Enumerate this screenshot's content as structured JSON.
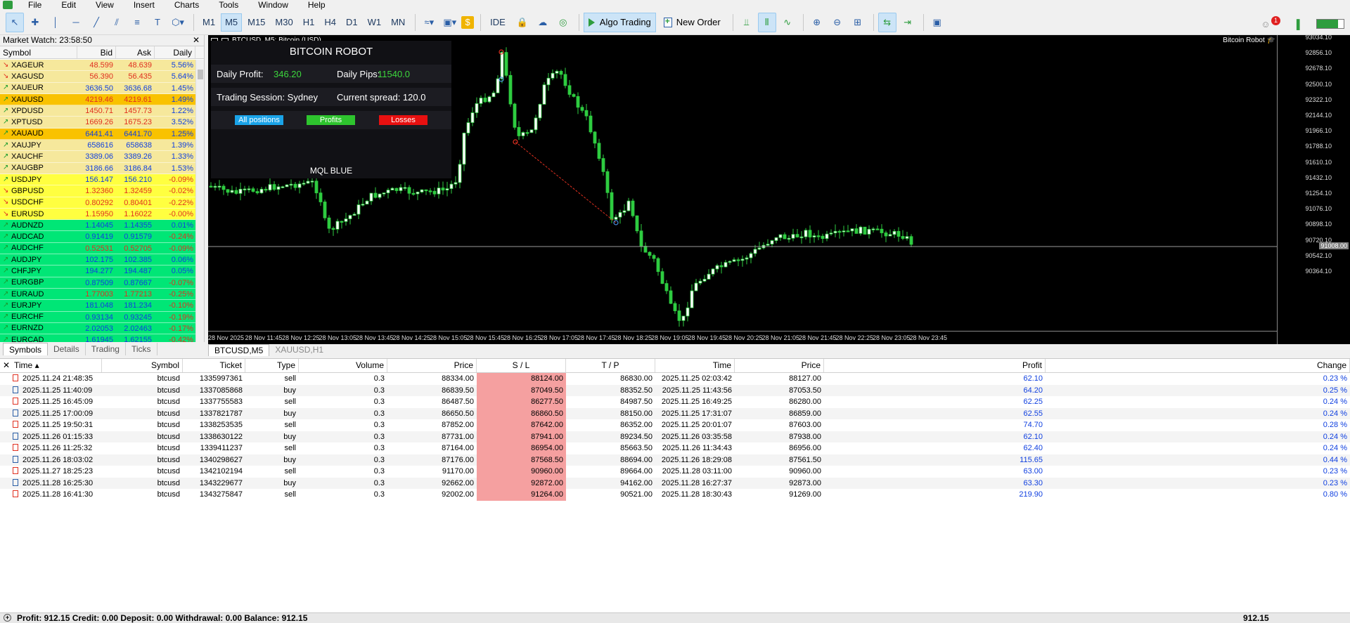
{
  "menu": [
    "File",
    "Edit",
    "View",
    "Insert",
    "Charts",
    "Tools",
    "Window",
    "Help"
  ],
  "toolbar": {
    "timeframes": [
      "M1",
      "M5",
      "M15",
      "M30",
      "H1",
      "H4",
      "D1",
      "W1",
      "MN"
    ],
    "active_timeframe": "M5",
    "ide_label": "IDE",
    "algo_trading_label": "Algo Trading",
    "new_order_label": "New Order",
    "notification_count": "1",
    "signal_level": 0.8
  },
  "market_watch": {
    "title": "Market Watch: 23:58:50",
    "columns": [
      "Symbol",
      "Bid",
      "Ask",
      "Daily Ch..."
    ],
    "rows": [
      {
        "symbol": "XAGEUR",
        "dir": "down",
        "bid": "48.599",
        "ask": "48.639",
        "change": "5.56%",
        "bg": "#f6e89c",
        "color": "red"
      },
      {
        "symbol": "XAGUSD",
        "dir": "down",
        "bid": "56.390",
        "ask": "56.435",
        "change": "5.64%",
        "bg": "#f6e89c",
        "color": "red"
      },
      {
        "symbol": "XAUEUR",
        "dir": "up",
        "bid": "3636.50",
        "ask": "3636.68",
        "change": "1.45%",
        "bg": "#f6e89c",
        "color": "blue"
      },
      {
        "symbol": "XAUUSD",
        "dir": "up",
        "bid": "4219.46",
        "ask": "4219.61",
        "change": "1.49%",
        "bg": "#f9c200",
        "color": "red"
      },
      {
        "symbol": "XPDUSD",
        "dir": "up",
        "bid": "1450.71",
        "ask": "1457.73",
        "change": "1.22%",
        "bg": "#f6e89c",
        "color": "red"
      },
      {
        "symbol": "XPTUSD",
        "dir": "up",
        "bid": "1669.26",
        "ask": "1675.23",
        "change": "3.52%",
        "bg": "#f6e89c",
        "color": "red"
      },
      {
        "symbol": "XAUAUD",
        "dir": "up",
        "bid": "6441.41",
        "ask": "6441.70",
        "change": "1.25%",
        "bg": "#f9c200",
        "color": "blue"
      },
      {
        "symbol": "XAUJPY",
        "dir": "up",
        "bid": "658616",
        "ask": "658638",
        "change": "1.39%",
        "bg": "#f6e89c",
        "color": "blue"
      },
      {
        "symbol": "XAUCHF",
        "dir": "up",
        "bid": "3389.06",
        "ask": "3389.26",
        "change": "1.33%",
        "bg": "#f6e89c",
        "color": "blue"
      },
      {
        "symbol": "XAUGBP",
        "dir": "up",
        "bid": "3186.66",
        "ask": "3186.84",
        "change": "1.53%",
        "bg": "#f6e89c",
        "color": "blue"
      },
      {
        "symbol": "USDJPY",
        "dir": "up",
        "bid": "156.147",
        "ask": "156.210",
        "change": "-0.09%",
        "bg": "#ffff40",
        "color": "blue"
      },
      {
        "symbol": "GBPUSD",
        "dir": "down",
        "bid": "1.32360",
        "ask": "1.32459",
        "change": "-0.02%",
        "bg": "#ffff40",
        "color": "red"
      },
      {
        "symbol": "USDCHF",
        "dir": "down",
        "bid": "0.80292",
        "ask": "0.80401",
        "change": "-0.22%",
        "bg": "#ffff40",
        "color": "red"
      },
      {
        "symbol": "EURUSD",
        "dir": "down",
        "bid": "1.15950",
        "ask": "1.16022",
        "change": "-0.00%",
        "bg": "#ffff40",
        "color": "red"
      },
      {
        "symbol": "AUDNZD",
        "dir": "up",
        "bid": "1.14045",
        "ask": "1.14355",
        "change": "0.01%",
        "bg": "#00e676",
        "color": "blue"
      },
      {
        "symbol": "AUDCAD",
        "dir": "up",
        "bid": "0.91419",
        "ask": "0.91579",
        "change": "-0.24%",
        "bg": "#00e676",
        "color": "blue"
      },
      {
        "symbol": "AUDCHF",
        "dir": "up",
        "bid": "0.52531",
        "ask": "0.52705",
        "change": "-0.09%",
        "bg": "#00e676",
        "color": "red"
      },
      {
        "symbol": "AUDJPY",
        "dir": "up",
        "bid": "102.175",
        "ask": "102.385",
        "change": "0.06%",
        "bg": "#00e676",
        "color": "blue"
      },
      {
        "symbol": "CHFJPY",
        "dir": "up",
        "bid": "194.277",
        "ask": "194.487",
        "change": "0.05%",
        "bg": "#00e676",
        "color": "blue"
      },
      {
        "symbol": "EURGBP",
        "dir": "up",
        "bid": "0.87509",
        "ask": "0.87667",
        "change": "-0.07%",
        "bg": "#00e676",
        "color": "blue"
      },
      {
        "symbol": "EURAUD",
        "dir": "up",
        "bid": "1.77003",
        "ask": "1.77213",
        "change": "-0.25%",
        "bg": "#00e676",
        "color": "red"
      },
      {
        "symbol": "EURJPY",
        "dir": "up",
        "bid": "181.048",
        "ask": "181.234",
        "change": "-0.10%",
        "bg": "#00e676",
        "color": "blue"
      },
      {
        "symbol": "EURCHF",
        "dir": "up",
        "bid": "0.93134",
        "ask": "0.93245",
        "change": "-0.19%",
        "bg": "#00e676",
        "color": "blue"
      },
      {
        "symbol": "EURNZD",
        "dir": "up",
        "bid": "2.02053",
        "ask": "2.02463",
        "change": "-0.17%",
        "bg": "#00e676",
        "color": "blue"
      },
      {
        "symbol": "EURCAD",
        "dir": "up",
        "bid": "1.61945",
        "ask": "1.62155",
        "change": "-0.42%",
        "bg": "#00e676",
        "color": "blue"
      }
    ],
    "tabs": [
      "Symbols",
      "Details",
      "Trading",
      "Ticks"
    ]
  },
  "chart": {
    "title": "BTCUSD, M5:  Bitcoin (USD)",
    "robot_label": "Bitcoin Robot",
    "current_price": "91008.00",
    "price_labels": [
      "93034.10",
      "92856.10",
      "92678.10",
      "92500.10",
      "92322.10",
      "92144.10",
      "91966.10",
      "91788.10",
      "91610.10",
      "91432.10",
      "91254.10",
      "91076.10",
      "90898.10",
      "90720.10",
      "90542.10",
      "90364.10"
    ],
    "time_labels": [
      "28 Nov 2025",
      "28 Nov 11:45",
      "28 Nov 12:25",
      "28 Nov 13:05",
      "28 Nov 13:45",
      "28 Nov 14:25",
      "28 Nov 15:05",
      "28 Nov 15:45",
      "28 Nov 16:25",
      "28 Nov 17:05",
      "28 Nov 17:45",
      "28 Nov 18:25",
      "28 Nov 19:05",
      "28 Nov 19:45",
      "28 Nov 20:25",
      "28 Nov 21:05",
      "28 Nov 21:45",
      "28 Nov 22:25",
      "28 Nov 23:05",
      "28 Nov 23:45"
    ],
    "tabs": [
      "BTCUSD,M5",
      "XAUUSD,H1"
    ]
  },
  "robot": {
    "title": "BITCOIN ROBOT",
    "daily_profit_label": "Daily Profit:",
    "daily_profit_value": "346.20",
    "daily_pips_label": "Daily Pips:",
    "daily_pips_value": "11540.0",
    "session_label": "Trading Session: Sydney",
    "spread_label": "Current spread: 120.0",
    "btn_all": "All positions",
    "btn_profits": "Profits",
    "btn_losses": "Losses",
    "footer": "MQL BLUE",
    "color_all": "#1aa3e8",
    "color_profits": "#2ec42e",
    "color_losses": "#e81010"
  },
  "history": {
    "columns": [
      "Time",
      "Symbol",
      "Ticket",
      "Type",
      "Volume",
      "Price",
      "S / L",
      "T / P",
      "Time",
      "Price",
      "Profit",
      "Change"
    ],
    "rows": [
      {
        "time": "2025.11.24 21:48:35",
        "symbol": "btcusd",
        "ticket": "1335997361",
        "type": "sell",
        "volume": "0.3",
        "price": "88334.00",
        "sl": "88124.00",
        "tp": "86830.00",
        "time2": "2025.11.25 02:03:42",
        "price2": "88127.00",
        "profit": "62.10",
        "change": "0.23 %"
      },
      {
        "time": "2025.11.25 11:40:09",
        "symbol": "btcusd",
        "ticket": "1337085868",
        "type": "buy",
        "volume": "0.3",
        "price": "86839.50",
        "sl": "87049.50",
        "tp": "88352.50",
        "time2": "2025.11.25 11:43:56",
        "price2": "87053.50",
        "profit": "64.20",
        "change": "0.25 %"
      },
      {
        "time": "2025.11.25 16:45:09",
        "symbol": "btcusd",
        "ticket": "1337755583",
        "type": "sell",
        "volume": "0.3",
        "price": "86487.50",
        "sl": "86277.50",
        "tp": "84987.50",
        "time2": "2025.11.25 16:49:25",
        "price2": "86280.00",
        "profit": "62.25",
        "change": "0.24 %"
      },
      {
        "time": "2025.11.25 17:00:09",
        "symbol": "btcusd",
        "ticket": "1337821787",
        "type": "buy",
        "volume": "0.3",
        "price": "86650.50",
        "sl": "86860.50",
        "tp": "88150.00",
        "time2": "2025.11.25 17:31:07",
        "price2": "86859.00",
        "profit": "62.55",
        "change": "0.24 %"
      },
      {
        "time": "2025.11.25 19:50:31",
        "symbol": "btcusd",
        "ticket": "1338253535",
        "type": "sell",
        "volume": "0.3",
        "price": "87852.00",
        "sl": "87642.00",
        "tp": "86352.00",
        "time2": "2025.11.25 20:01:07",
        "price2": "87603.00",
        "profit": "74.70",
        "change": "0.28 %"
      },
      {
        "time": "2025.11.26 01:15:33",
        "symbol": "btcusd",
        "ticket": "1338630122",
        "type": "buy",
        "volume": "0.3",
        "price": "87731.00",
        "sl": "87941.00",
        "tp": "89234.50",
        "time2": "2025.11.26 03:35:58",
        "price2": "87938.00",
        "profit": "62.10",
        "change": "0.24 %"
      },
      {
        "time": "2025.11.26 11:25:32",
        "symbol": "btcusd",
        "ticket": "1339411237",
        "type": "sell",
        "volume": "0.3",
        "price": "87164.00",
        "sl": "86954.00",
        "tp": "85663.50",
        "time2": "2025.11.26 11:34:43",
        "price2": "86956.00",
        "profit": "62.40",
        "change": "0.24 %"
      },
      {
        "time": "2025.11.26 18:03:02",
        "symbol": "btcusd",
        "ticket": "1340298627",
        "type": "buy",
        "volume": "0.3",
        "price": "87176.00",
        "sl": "87568.50",
        "tp": "88694.00",
        "time2": "2025.11.26 18:29:08",
        "price2": "87561.50",
        "profit": "115.65",
        "change": "0.44 %"
      },
      {
        "time": "2025.11.27 18:25:23",
        "symbol": "btcusd",
        "ticket": "1342102194",
        "type": "sell",
        "volume": "0.3",
        "price": "91170.00",
        "sl": "90960.00",
        "tp": "89664.00",
        "time2": "2025.11.28 03:11:00",
        "price2": "90960.00",
        "profit": "63.00",
        "change": "0.23 %"
      },
      {
        "time": "2025.11.28 16:25:30",
        "symbol": "btcusd",
        "ticket": "1343229677",
        "type": "buy",
        "volume": "0.3",
        "price": "92662.00",
        "sl": "92872.00",
        "tp": "94162.00",
        "time2": "2025.11.28 16:27:37",
        "price2": "92873.00",
        "profit": "63.30",
        "change": "0.23 %"
      },
      {
        "time": "2025.11.28 16:41:30",
        "symbol": "btcusd",
        "ticket": "1343275847",
        "type": "sell",
        "volume": "0.3",
        "price": "92002.00",
        "sl": "91264.00",
        "tp": "90521.00",
        "time2": "2025.11.28 18:30:43",
        "price2": "91269.00",
        "profit": "219.90",
        "change": "0.80 %"
      }
    ]
  },
  "status": {
    "summary": "Profit: 912.15  Credit: 0.00  Deposit: 0.00  Withdrawal: 0.00  Balance: 912.15",
    "total": "912.15"
  }
}
